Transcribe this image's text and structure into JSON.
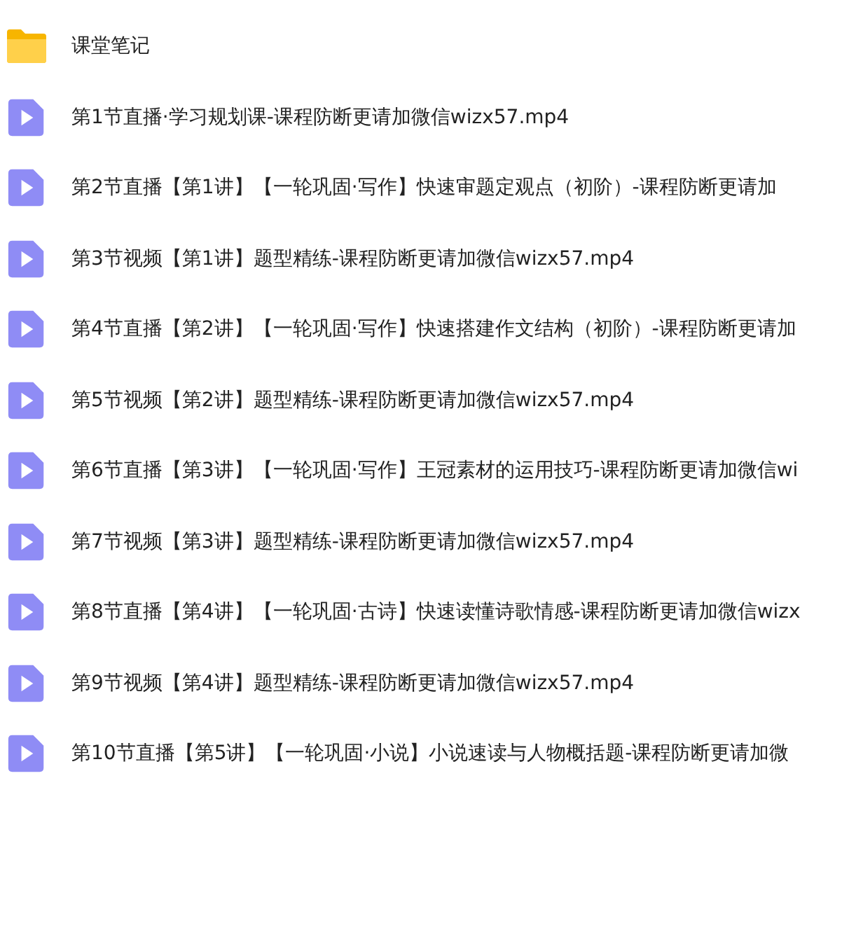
{
  "files": [
    {
      "kind": "folder",
      "name": "课堂笔记"
    },
    {
      "kind": "video",
      "name": "第1节直播·学习规划课-课程防断更请加微信wizx57.mp4"
    },
    {
      "kind": "video",
      "name": "第2节直播【第1讲】【一轮巩固·写作】快速审题定观点（初阶）-课程防断更请加"
    },
    {
      "kind": "video",
      "name": "第3节视频【第1讲】题型精练-课程防断更请加微信wizx57.mp4"
    },
    {
      "kind": "video",
      "name": "第4节直播【第2讲】【一轮巩固·写作】快速搭建作文结构（初阶）-课程防断更请加"
    },
    {
      "kind": "video",
      "name": "第5节视频【第2讲】题型精练-课程防断更请加微信wizx57.mp4"
    },
    {
      "kind": "video",
      "name": "第6节直播【第3讲】【一轮巩固·写作】王冠素材的运用技巧-课程防断更请加微信wi"
    },
    {
      "kind": "video",
      "name": "第7节视频【第3讲】题型精练-课程防断更请加微信wizx57.mp4"
    },
    {
      "kind": "video",
      "name": "第8节直播【第4讲】【一轮巩固·古诗】快速读懂诗歌情感-课程防断更请加微信wizx"
    },
    {
      "kind": "video",
      "name": "第9节视频【第4讲】题型精练-课程防断更请加微信wizx57.mp4"
    },
    {
      "kind": "video",
      "name": "第10节直播【第5讲】【一轮巩固·小说】小说速读与人物概括题-课程防断更请加微"
    }
  ]
}
